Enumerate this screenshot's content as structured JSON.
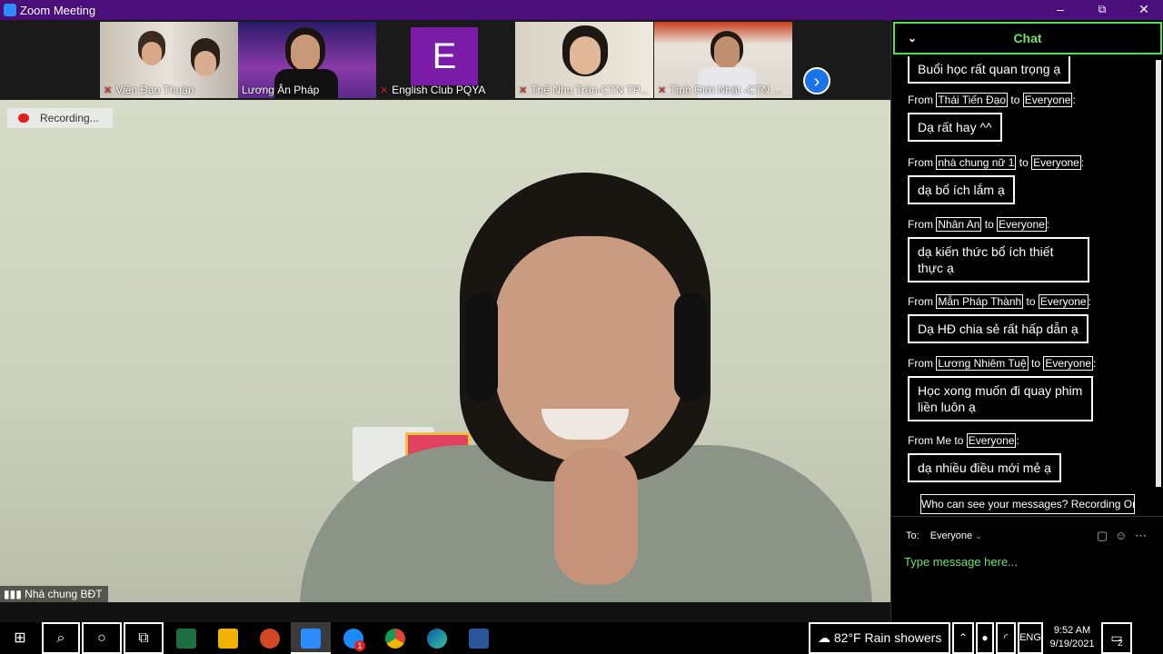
{
  "window": {
    "title": "Zoom Meeting",
    "minimize": "–",
    "restore": "⧉",
    "close": "✕"
  },
  "participants": [
    {
      "name": "Viên Đạo Thuận"
    },
    {
      "name": "Lương Ân Pháp"
    },
    {
      "name": "English Club PQYA",
      "initial": "E"
    },
    {
      "name": "Thể Nhu Trần-CTN TP..."
    },
    {
      "name": "Tịnh Giới Nhật -CTN ..."
    }
  ],
  "main_video": {
    "recording_label": "Recording...",
    "speaker_name": "Nhà chung BĐT"
  },
  "chat": {
    "title": "Chat",
    "first_message": "Buổi học rất quan trọng ạ",
    "messages": [
      {
        "from": "Thái Tiến Đạo",
        "to": "Everyone",
        "text": "Dạ rất hay ^^"
      },
      {
        "from": "nhà chung nữ 1",
        "to": "Everyone",
        "text": "dạ bổ ích lắm ạ"
      },
      {
        "from": "Nhân An",
        "to": "Everyone",
        "text": "dạ kiến thức bổ ích thiết thực ạ"
      },
      {
        "from": "Mẫn Pháp Thành",
        "to": "Everyone",
        "text": "Dạ HĐ chia sẻ rất hấp dẫn ạ"
      },
      {
        "from": "Lương Nhiêm Tuệ",
        "to": "Everyone",
        "text": "Học xong muốn đi quay phim liền luôn ạ"
      },
      {
        "from": "Me",
        "to": "Everyone",
        "text": "dạ nhiều điều mới mẻ ạ"
      }
    ],
    "from_label": "From",
    "to_word": "to",
    "privacy_notice": "Who can see your messages? Recording On",
    "to_label": "To:",
    "recipient": "Everyone",
    "input_placeholder": "Type message here..."
  },
  "taskbar": {
    "weather_temp": "82°F",
    "weather_desc": "Rain showers",
    "lang": "ENG",
    "time": "9:52 AM",
    "date": "9/19/2021",
    "notification_count": "2",
    "chrome_badge": "1"
  },
  "colors": {
    "titlebar": "#4a0f7a",
    "chat_accent": "#6be36b",
    "zoom_blue": "#2d8cff"
  }
}
